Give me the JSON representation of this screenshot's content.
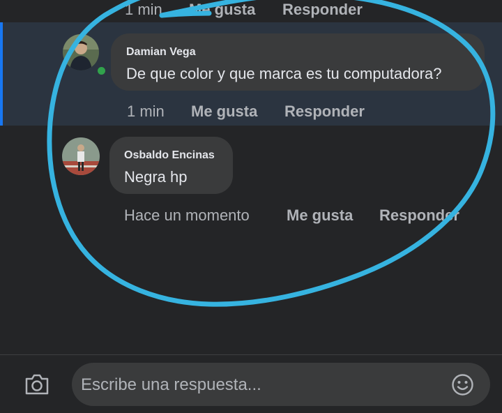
{
  "top_row": {
    "time": "1 min",
    "like_label": "Me gusta",
    "reply_label": "Responder"
  },
  "comments": [
    {
      "author": "Damian Vega",
      "text": "De que color y que marca es tu computadora?",
      "time": "1 min",
      "like_label": "Me gusta",
      "reply_label": "Responder",
      "online": true,
      "highlighted": true
    },
    {
      "author": "Osbaldo Encinas",
      "text": "Negra hp",
      "time": "Hace un momento",
      "like_label": "Me gusta",
      "reply_label": "Responder",
      "online": false,
      "highlighted": false
    }
  ],
  "composer": {
    "placeholder": "Escribe una respuesta...",
    "camera_icon": "camera-icon",
    "emoji_icon": "emoji-icon"
  },
  "colors": {
    "background": "#242527",
    "highlight": "#2b3440",
    "accent_bar": "#1877f2",
    "bubble": "#3a3b3c",
    "online": "#31a24c",
    "annotation_circle": "#36b3e0"
  }
}
